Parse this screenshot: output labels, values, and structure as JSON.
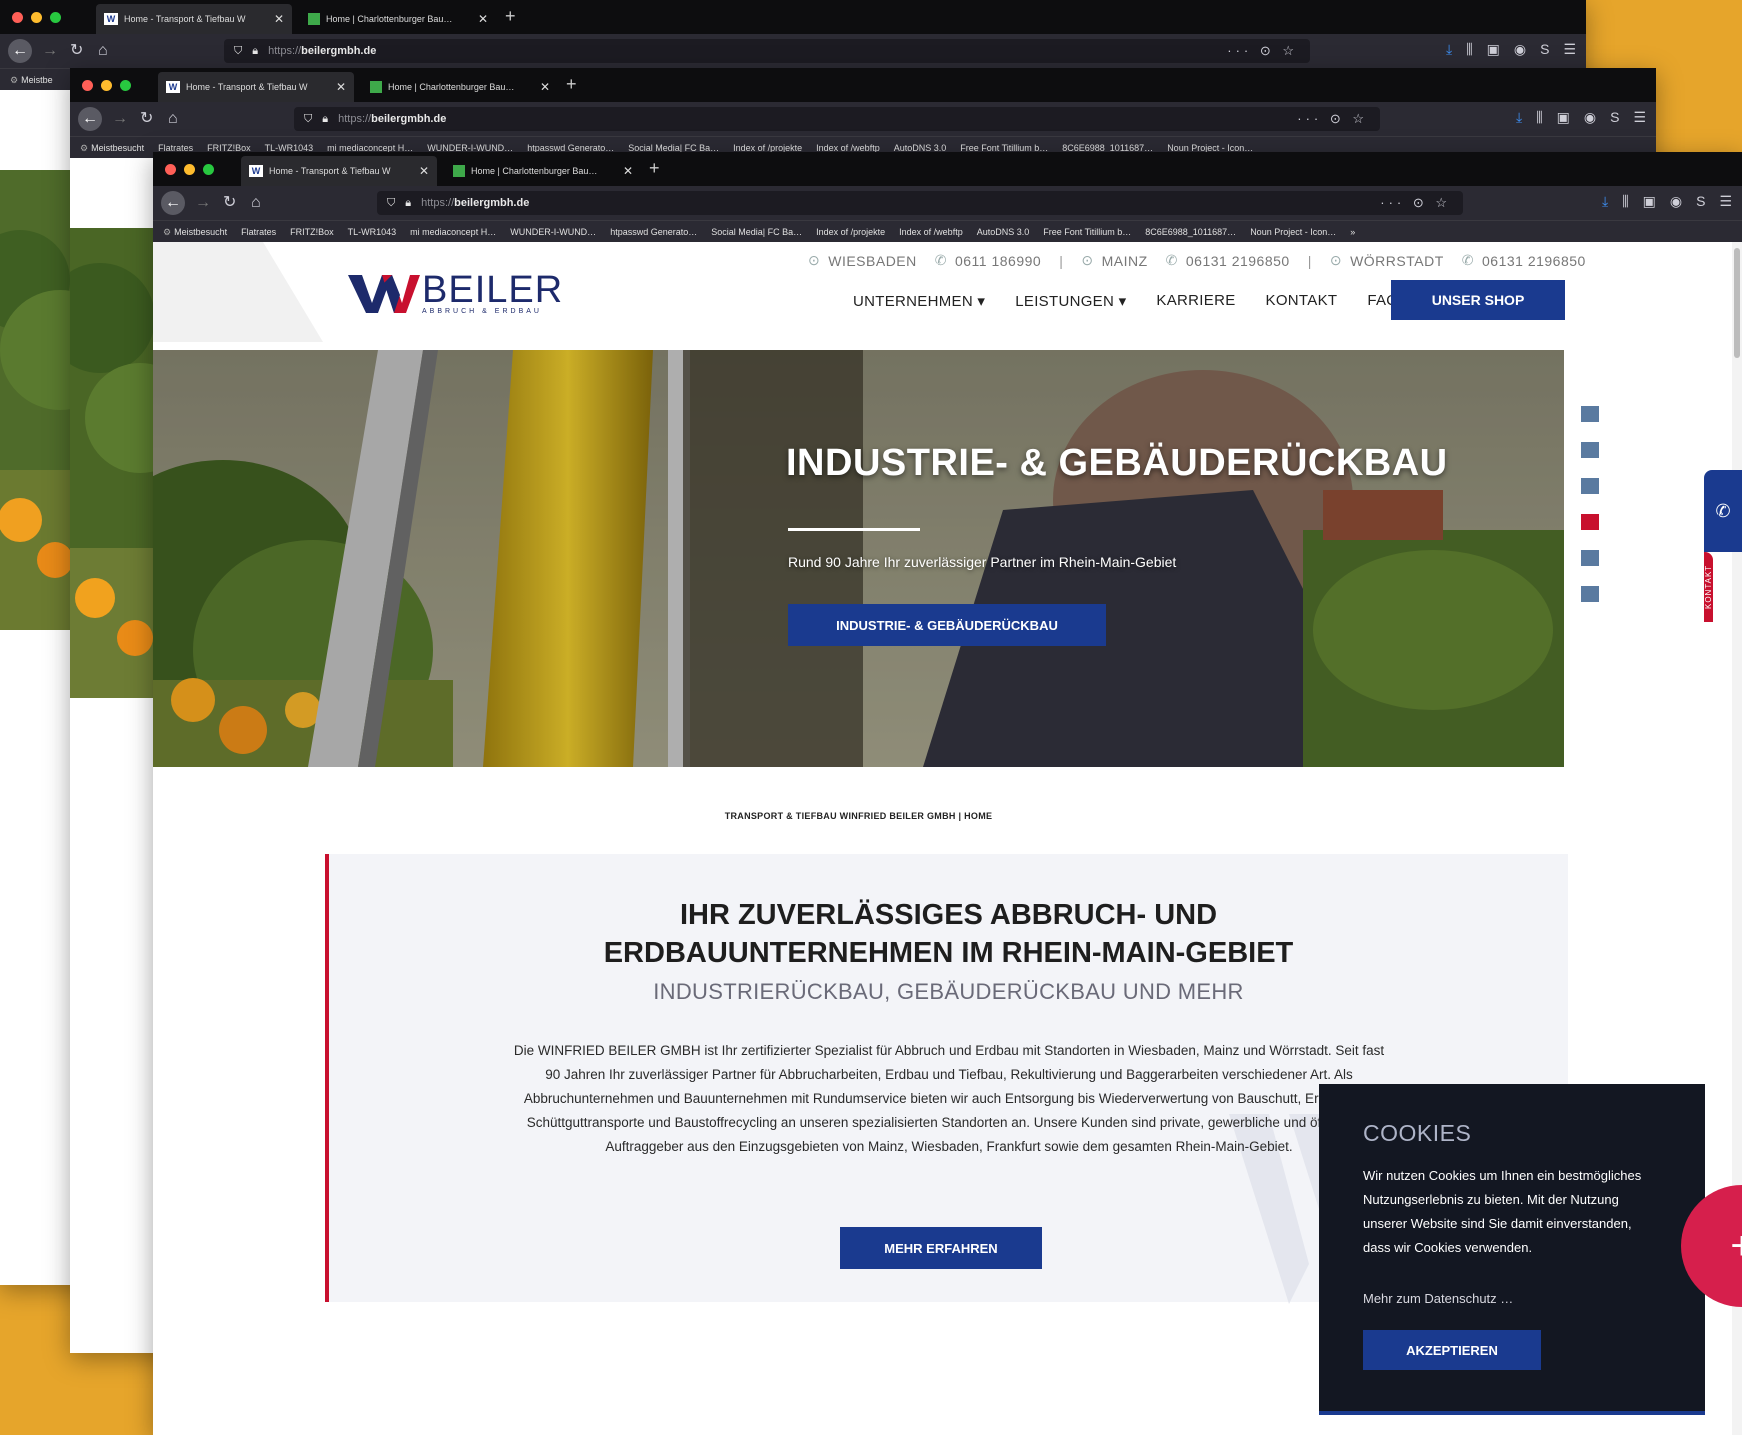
{
  "browser": {
    "tab1": "Home - Transport & Tiefbau W",
    "tab2": "Home | Charlottenburger Bau…",
    "url_prefix": "https://",
    "url_domain": "beilergmbh.de",
    "url_tail": "··· ⊙ ☆",
    "bookmarks_short": [
      "Meistbe"
    ],
    "bookmarks": [
      "Meistbesucht",
      "Flatrates",
      "FRITZ!Box",
      "TL-WR1043",
      "mi mediaconcept H…",
      "WUNDER-I-WUND…",
      "htpasswd Generato…",
      "Social Media| FC Ba…",
      "Index of /projekte",
      "Index of /webftp",
      "AutoDNS 3.0",
      "Free Font Titillium b…",
      "8C6E6988_1011687…",
      "Noun Project - Icon…",
      "»"
    ]
  },
  "site": {
    "contact": {
      "city1": "WIESBADEN",
      "phone1": "0611 186990",
      "city2": "MAINZ",
      "phone2": "06131 2196850",
      "city3": "WÖRRSTADT",
      "phone3": "06131 2196850"
    },
    "logo_main": "BEILER",
    "logo_sub": "ABBRUCH & ERDBAU",
    "menu": [
      "UNTERNEHMEN ▾",
      "LEISTUNGEN ▾",
      "KARRIERE",
      "KONTAKT",
      "FAQ"
    ],
    "shop_label": "UNSER SHOP",
    "hero": {
      "title": "INDUSTRIE- & GEBÄUDERÜCKBAU",
      "subtitle": "Rund 90 Jahre Ihr zuverlässiger Partner im Rhein-Main-Gebiet",
      "button": "INDUSTRIE- & GEBÄUDERÜCKBAU"
    },
    "side_tab_label": "KONTAKT",
    "breadcrumb": "TRANSPORT & TIEFBAU WINFRIED BEILER GMBH  |  HOME",
    "content": {
      "title_line1": "IHR ZUVERLÄSSIGES ABBRUCH- UND",
      "title_line2": "ERDBAUUNTERNEHMEN IM RHEIN-MAIN-GEBIET",
      "subtitle": "INDUSTRIERÜCKBAU, GEBÄUDERÜCKBAU UND MEHR",
      "text": "Die WINFRIED BEILER GMBH ist Ihr zertifizierter Spezialist für Abbruch und Erdbau mit Standorten in Wiesbaden, Mainz und Wörrstadt. Seit fast 90 Jahren Ihr zuverlässiger Partner für Abbrucharbeiten, Erdbau und Tiefbau, Rekultivierung und Baggerarbeiten verschiedener Art. Als Abbruchunternehmen und Bauunternehmen mit Rundumservice bieten wir auch Entsorgung bis Wiederverwertung von Bauschutt, Erdaushub, Schüttguttransporte und Baustoffrecycling an unseren spezialisierten Standorten an. Unsere Kunden sind private, gewerbliche und öffentliche Auftraggeber aus den Einzugsgebieten von Mainz, Wiesbaden, Frankfurt sowie dem gesamten Rhein-Main-Gebiet.",
      "button": "MEHR ERFAHREN"
    },
    "cookie": {
      "title": "COOKIES",
      "text": "Wir nutzen Cookies um Ihnen ein bestmögliches Nutzungserlebnis zu bieten. Mit der Nutzung unserer Website sind Sie damit einverstanden, dass wir Cookies verwenden.",
      "more": "Mehr zum Datenschutz …",
      "accept": "AKZEPTIEREN"
    },
    "slider_active_index": 3,
    "colors": {
      "brand_blue": "#1a3a8f",
      "brand_red": "#c8102e",
      "background": "#e6a52b",
      "fab": "#d61f4c"
    }
  }
}
